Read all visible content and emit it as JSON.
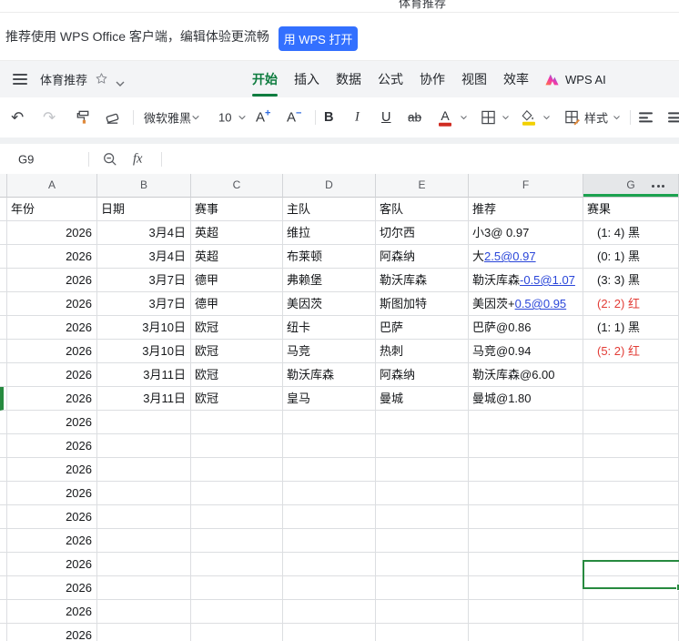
{
  "colors": {
    "accent_green": "#0e7c3f",
    "selection_green": "#278a3f",
    "header_underline_green": "#1ba24f",
    "link_blue": "#2a46d9",
    "result_red": "#e23c36",
    "button_blue": "#3370ff"
  },
  "browser": {
    "page_title": "体育推荐"
  },
  "banner": {
    "message": "推荐使用 WPS Office 客户端，编辑体验更流畅",
    "open_button": "用 WPS 打开"
  },
  "menu": {
    "doc_title": "体育推荐",
    "tabs": [
      "开始",
      "插入",
      "数据",
      "公式",
      "协作",
      "视图",
      "效率"
    ],
    "active_tab": "开始",
    "wps_ai": "WPS AI"
  },
  "toolbar": {
    "font_name": "微软雅黑",
    "font_size": "10",
    "bold": "B",
    "italic": "I",
    "underline": "U",
    "strike": "ab",
    "grow_letter": "A",
    "grow_sign": "+",
    "shrink_letter": "A",
    "shrink_sign": "−",
    "font_color_letter": "A",
    "style_label": "样式"
  },
  "formula_bar": {
    "cell_ref": "G9",
    "fx": "fx"
  },
  "grid": {
    "column_letters": [
      "A",
      "B",
      "C",
      "D",
      "E",
      "F",
      "G"
    ],
    "selected_column": "G",
    "selected_cell": "G9",
    "header_row": [
      "年份",
      "日期",
      "赛事",
      "主队",
      "客队",
      "推荐",
      "赛果"
    ],
    "rows": [
      {
        "year": "2026",
        "date": "3月4日",
        "league": "英超",
        "home": "维拉",
        "away": "切尔西",
        "tip": [
          {
            "t": "小3@ 0.97"
          }
        ],
        "result": "(1: 4) 黑",
        "result_color": "black"
      },
      {
        "year": "2026",
        "date": "3月4日",
        "league": "英超",
        "home": "布莱顿",
        "away": "阿森纳",
        "tip": [
          {
            "t": "大"
          },
          {
            "t": "2.5@0.97",
            "link": true
          }
        ],
        "result": "(0: 1) 黑",
        "result_color": "black"
      },
      {
        "year": "2026",
        "date": "3月7日",
        "league": "德甲",
        "home": "弗赖堡",
        "away": "勒沃库森",
        "tip": [
          {
            "t": "勒沃库森"
          },
          {
            "t": "-0.5@1.07",
            "link": true
          }
        ],
        "result": "(3: 3) 黑",
        "result_color": "black"
      },
      {
        "year": "2026",
        "date": "3月7日",
        "league": "德甲",
        "home": "美因茨",
        "away": "斯图加特",
        "tip": [
          {
            "t": "美因茨+"
          },
          {
            "t": "0.5@0.95",
            "link": true
          }
        ],
        "result": "(2: 2) 红",
        "result_color": "red"
      },
      {
        "year": "2026",
        "date": "3月10日",
        "league": "欧冠",
        "home": "纽卡",
        "away": "巴萨",
        "tip": [
          {
            "t": "巴萨@0.86"
          }
        ],
        "result": "(1: 1) 黑",
        "result_color": "black"
      },
      {
        "year": "2026",
        "date": "3月10日",
        "league": "欧冠",
        "home": "马竞",
        "away": "热刺",
        "tip": [
          {
            "t": "马竞@0.94"
          }
        ],
        "result": "(5: 2) 红",
        "result_color": "red"
      },
      {
        "year": "2026",
        "date": "3月11日",
        "league": "欧冠",
        "home": "勒沃库森",
        "away": "阿森纳",
        "tip": [
          {
            "t": "勒沃库森@6.00"
          }
        ],
        "result": "",
        "result_color": "black"
      },
      {
        "year": "2026",
        "date": "3月11日",
        "league": "欧冠",
        "home": "皇马",
        "away": "曼城",
        "tip": [
          {
            "t": "曼城@1.80"
          }
        ],
        "result": "",
        "result_color": "black",
        "selected": true
      },
      {
        "year": "2026"
      },
      {
        "year": "2026"
      },
      {
        "year": "2026"
      },
      {
        "year": "2026"
      },
      {
        "year": "2026"
      },
      {
        "year": "2026"
      },
      {
        "year": "2026"
      },
      {
        "year": "2026"
      },
      {
        "year": "2026"
      },
      {
        "year": "2026"
      }
    ]
  }
}
